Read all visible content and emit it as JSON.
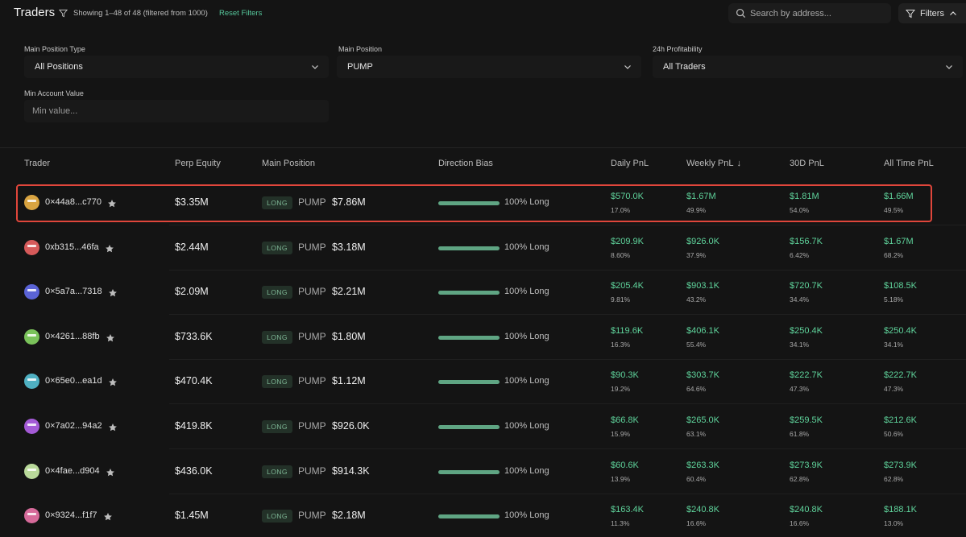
{
  "header": {
    "title": "Traders",
    "showing": "Showing 1–48 of 48 (filtered from 1000)",
    "reset_label": "Reset Filters",
    "search_placeholder": "Search by address...",
    "filters_label": "Filters"
  },
  "filters": {
    "main_position_type": {
      "label": "Main Position Type",
      "value": "All Positions"
    },
    "main_position": {
      "label": "Main Position",
      "value": "PUMP"
    },
    "profitability": {
      "label": "24h Profitability",
      "value": "All Traders"
    },
    "min_account": {
      "label": "Min Account Value",
      "placeholder": "Min value..."
    }
  },
  "columns": {
    "trader": "Trader",
    "perp_equity": "Perp Equity",
    "main_position": "Main Position",
    "direction_bias": "Direction Bias",
    "daily_pnl": "Daily PnL",
    "weekly_pnl": "Weekly PnL",
    "weekly_sort_arrow": "↓",
    "pnl_30d": "30D PnL",
    "all_time_pnl": "All Time PnL"
  },
  "colors": {
    "accent_green": "#5fd49c",
    "highlight_red": "#e0463b",
    "long_badge_bg": "#233128"
  },
  "rows": [
    {
      "address": "0×44a8...c770",
      "equity": "$3.35M",
      "side": "LONG",
      "asset": "PUMP",
      "position": "$7.86M",
      "bias_fraction": 1.0,
      "bias": "100% Long",
      "daily": "$570.0K",
      "daily_pct": "17.0%",
      "weekly": "$1.67M",
      "weekly_pct": "49.9%",
      "d30": "$1.81M",
      "d30_pct": "54.0%",
      "all": "$1.66M",
      "all_pct": "49.5%",
      "avatar_color": "#d9a441"
    },
    {
      "address": "0xb315...46fa",
      "equity": "$2.44M",
      "side": "LONG",
      "asset": "PUMP",
      "position": "$3.18M",
      "bias_fraction": 1.0,
      "bias": "100% Long",
      "daily": "$209.9K",
      "daily_pct": "8.60%",
      "weekly": "$926.0K",
      "weekly_pct": "37.9%",
      "d30": "$156.7K",
      "d30_pct": "6.42%",
      "all": "$1.67M",
      "all_pct": "68.2%",
      "avatar_color": "#d65a5a"
    },
    {
      "address": "0×5a7a...7318",
      "equity": "$2.09M",
      "side": "LONG",
      "asset": "PUMP",
      "position": "$2.21M",
      "bias_fraction": 1.0,
      "bias": "100% Long",
      "daily": "$205.4K",
      "daily_pct": "9.81%",
      "weekly": "$903.1K",
      "weekly_pct": "43.2%",
      "d30": "$720.7K",
      "d30_pct": "34.4%",
      "all": "$108.5K",
      "all_pct": "5.18%",
      "avatar_color": "#5a63d6"
    },
    {
      "address": "0×4261...88fb",
      "equity": "$733.6K",
      "side": "LONG",
      "asset": "PUMP",
      "position": "$1.80M",
      "bias_fraction": 1.0,
      "bias": "100% Long",
      "daily": "$119.6K",
      "daily_pct": "16.3%",
      "weekly": "$406.1K",
      "weekly_pct": "55.4%",
      "d30": "$250.4K",
      "d30_pct": "34.1%",
      "all": "$250.4K",
      "all_pct": "34.1%",
      "avatar_color": "#7ac25a"
    },
    {
      "address": "0×65e0...ea1d",
      "equity": "$470.4K",
      "side": "LONG",
      "asset": "PUMP",
      "position": "$1.12M",
      "bias_fraction": 1.0,
      "bias": "100% Long",
      "daily": "$90.3K",
      "daily_pct": "19.2%",
      "weekly": "$303.7K",
      "weekly_pct": "64.6%",
      "d30": "$222.7K",
      "d30_pct": "47.3%",
      "all": "$222.7K",
      "all_pct": "47.3%",
      "avatar_color": "#4fb0c2"
    },
    {
      "address": "0×7a02...94a2",
      "equity": "$419.8K",
      "side": "LONG",
      "asset": "PUMP",
      "position": "$926.0K",
      "bias_fraction": 1.0,
      "bias": "100% Long",
      "daily": "$66.8K",
      "daily_pct": "15.9%",
      "weekly": "$265.0K",
      "weekly_pct": "63.1%",
      "d30": "$259.5K",
      "d30_pct": "61.8%",
      "all": "$212.6K",
      "all_pct": "50.6%",
      "avatar_color": "#a45ad6"
    },
    {
      "address": "0×4fae...d904",
      "equity": "$436.0K",
      "side": "LONG",
      "asset": "PUMP",
      "position": "$914.3K",
      "bias_fraction": 1.0,
      "bias": "100% Long",
      "daily": "$60.6K",
      "daily_pct": "13.9%",
      "weekly": "$263.3K",
      "weekly_pct": "60.4%",
      "d30": "$273.9K",
      "d30_pct": "62.8%",
      "all": "$273.9K",
      "all_pct": "62.8%",
      "avatar_color": "#b9d99a"
    },
    {
      "address": "0×9324...f1f7",
      "equity": "$1.45M",
      "side": "LONG",
      "asset": "PUMP",
      "position": "$2.18M",
      "bias_fraction": 1.0,
      "bias": "100% Long",
      "daily": "$163.4K",
      "daily_pct": "11.3%",
      "weekly": "$240.8K",
      "weekly_pct": "16.6%",
      "d30": "$240.8K",
      "d30_pct": "16.6%",
      "all": "$188.1K",
      "all_pct": "13.0%",
      "avatar_color": "#d66a9a"
    }
  ]
}
